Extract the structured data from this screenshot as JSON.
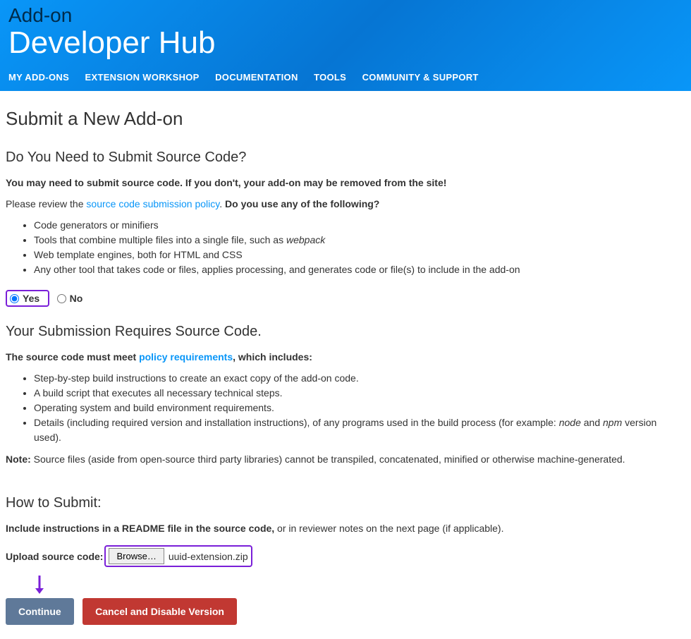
{
  "header": {
    "title_small": "Add-on",
    "title_large": "Developer Hub",
    "nav": [
      "MY ADD-ONS",
      "EXTENSION WORKSHOP",
      "DOCUMENTATION",
      "TOOLS",
      "COMMUNITY & SUPPORT"
    ]
  },
  "page": {
    "title": "Submit a New Add-on"
  },
  "section1": {
    "heading": "Do You Need to Submit Source Code?",
    "warning": "You may need to submit source code. If you don't, your add-on may be removed from the site!",
    "review_prefix": "Please review the ",
    "review_link": "source code submission policy",
    "review_suffix": ". ",
    "question": "Do you use any of the following?",
    "items": [
      "Code generators or minifiers",
      {
        "pre": "Tools that combine multiple files into a single file, such as ",
        "em": "webpack"
      },
      "Web template engines, both for HTML and CSS",
      "Any other tool that takes code or files, applies processing, and generates code or file(s) to include in the add-on"
    ],
    "radio_yes": "Yes",
    "radio_no": "No"
  },
  "section2": {
    "heading": "Your Submission Requires Source Code.",
    "req_prefix": "The source code must meet ",
    "req_link": "policy requirements",
    "req_suffix": ", which includes:",
    "items": [
      "Step-by-step build instructions to create an exact copy of the add-on code.",
      "A build script that executes all necessary technical steps.",
      "Operating system and build environment requirements.",
      {
        "pre": "Details (including required version and installation instructions), of any programs used in the build process (for example: ",
        "em1": "node",
        "mid": " and ",
        "em2": "npm",
        "post": " version used)."
      }
    ],
    "note_label": "Note:",
    "note_text": " Source files (aside from open-source third party libraries) cannot be transpiled, concatenated, minified or otherwise machine-generated."
  },
  "section3": {
    "heading": "How to Submit:",
    "instr_bold": "Include instructions in a README file in the source code,",
    "instr_rest": " or in reviewer notes on the next page (if applicable).",
    "upload_label": "Upload source code:",
    "browse_label": "Browse…",
    "file_name": "uuid-extension.zip"
  },
  "buttons": {
    "continue": "Continue",
    "cancel": "Cancel and Disable Version"
  }
}
